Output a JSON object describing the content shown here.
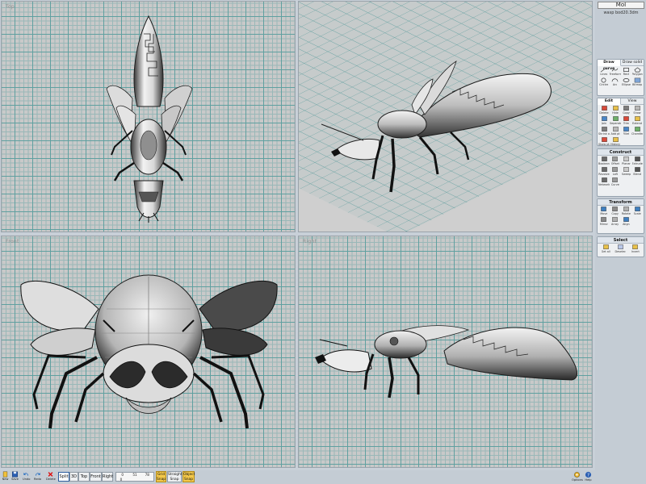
{
  "app": {
    "logo": "MoI",
    "file_name": "wasp bod20.3dm"
  },
  "viewports": {
    "top": "Top",
    "perspective": "3D",
    "front": "Front",
    "right": "Right"
  },
  "panels": {
    "draw": {
      "tabs": [
        "Draw curve",
        "Draw solid"
      ],
      "items": [
        "Lines",
        "Freeform",
        "Rect",
        "Polygon",
        "Circles",
        "Arc",
        "Ellipse",
        "Bitmap"
      ]
    },
    "edit": {
      "tabs": [
        "Edit",
        "View"
      ],
      "items": [
        "Delete",
        "Hide",
        "Copy",
        "Show",
        "Join",
        "Separate",
        "Trim",
        "Extend",
        "Shrink all",
        "Add pt",
        "Fillet",
        "Chamfer",
        "Show pts",
        "History"
      ]
    },
    "construct": {
      "title": "Construct",
      "items": [
        "Booleans",
        "Offset",
        "Planar",
        "Extrude",
        "Revolve",
        "Loft",
        "Sweep",
        "Blend",
        "Network",
        "Curve"
      ]
    },
    "transform": {
      "title": "Transform",
      "items": [
        "Move",
        "Copy",
        "Rotate",
        "Scale",
        "Mirror",
        "Array",
        "Align"
      ]
    },
    "select": {
      "title": "Select",
      "items": [
        "Get all",
        "Deselect all",
        "Invert"
      ]
    }
  },
  "toolbar": {
    "left_buttons": [
      "New",
      "Save",
      "Undo",
      "Redo",
      "Delete"
    ],
    "views": [
      "Split",
      "3D",
      "Top",
      "Front",
      "Right"
    ],
    "active_view": "Split",
    "coords": {
      "x": "0",
      "y": "51",
      "z": "78"
    },
    "coords_row2": "0",
    "grid_snap": [
      "Grid",
      "Snap"
    ],
    "straight_snap": [
      "Straight",
      "Snap"
    ],
    "object_snap": [
      "Object",
      "Snap"
    ],
    "right_buttons": [
      "Options",
      "Help"
    ]
  },
  "colors": {
    "grid_major": "#5fa0a0",
    "grid_minor": "#99b8b8",
    "viewport_bg": "#c9c9c9",
    "panel_bg": "#eef0f2",
    "snap_on": "#f3c84a"
  }
}
